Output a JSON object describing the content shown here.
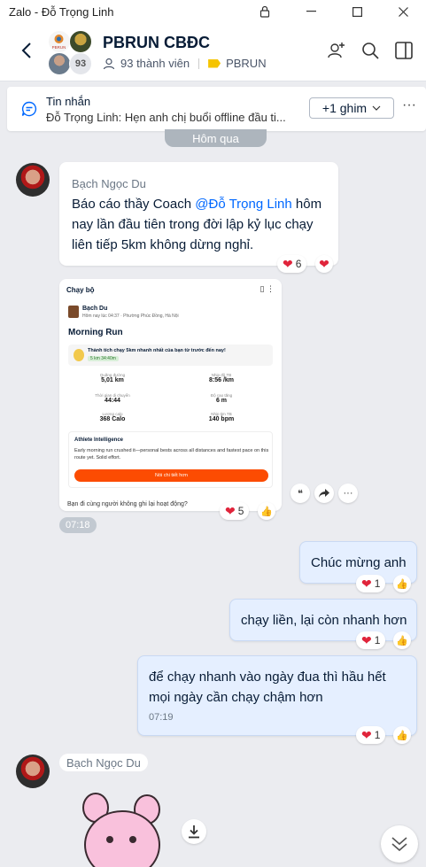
{
  "window": {
    "title": "Zalo - Đỗ Trọng Linh"
  },
  "header": {
    "group_name": "PBRUN CBĐC",
    "member_count_badge": "93",
    "members_text": "93 thành viên",
    "tag_label": "PBRUN",
    "avatar_logo_text": "PBRUN"
  },
  "pinned": {
    "title": "Tin nhắn",
    "text": "Đỗ Trọng Linh: Hẹn anh chị buổi offline đầu ti...",
    "button_label": "+1 ghim",
    "more_label": "···"
  },
  "date_separator": "Hôm qua",
  "messages": [
    {
      "sender": "Bạch Ngọc Du",
      "text_before": "Báo cáo thầy Coach ",
      "mention": "@Đỗ Trọng Linh",
      "text_after": " hôm nay lần đầu tiên trong đời lập kỷ lục chạy liên tiếp 5km không dừng nghỉ.",
      "reaction_count": "6"
    },
    {
      "card": {
        "header": "Chạy bộ",
        "user": "Bạch Du",
        "when": "Hôm nay lúc 04:37 · Phường Phúc Đồng, Hà Nội",
        "activity_title": "Morning Run",
        "achievement": "Thành tích chạy 5km nhanh nhất của bạn từ trước đến nay!",
        "achievement_pr": "5 km 34:40m",
        "stats": [
          {
            "label": "Quãng đường",
            "value": "5,01 km"
          },
          {
            "label": "Nhịp độ TB",
            "value": "8:56 /km"
          },
          {
            "label": "Thời gian di chuyển",
            "value": "44:44"
          },
          {
            "label": "Độ cao tăng",
            "value": "6 m"
          },
          {
            "label": "Lượng calo",
            "value": "368 Calo"
          },
          {
            "label": "Nhịp tim TB",
            "value": "140 bpm"
          }
        ],
        "ai_title": "Athlete Intelligence",
        "ai_text": "Early morning run crushed it—personal bests across all distances and fastest pace on this route yet. Solid effort.",
        "ai_button": "Nói chi tiết hơn",
        "footer": "Bạn đi cùng người không ghi lại hoạt động?"
      },
      "time": "07:18",
      "reaction_count": "5"
    },
    {
      "text": "Chúc mừng anh",
      "reaction_count": "1"
    },
    {
      "text": "chạy liền, lại còn nhanh hơn",
      "reaction_count": "1"
    },
    {
      "text": "để chạy nhanh vào ngày đua thì hầu hết mọi ngày cần chạy chậm hơn",
      "time": "07:19",
      "reaction_count": "1"
    },
    {
      "sender": "Bạch Ngọc Du"
    }
  ]
}
